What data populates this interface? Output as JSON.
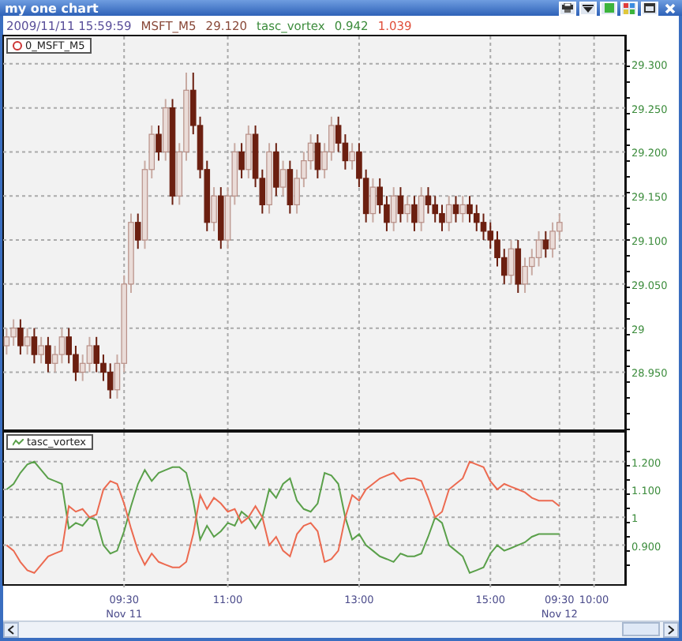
{
  "window": {
    "title": "my one chart"
  },
  "info_bar": [
    {
      "text": "2009/11/11 15:59:59",
      "color": "#5a4f9a"
    },
    {
      "text": "MSFT_M5",
      "color": "#8a4a3a"
    },
    {
      "text": "29.120",
      "color": "#8a4a3a"
    },
    {
      "text": "tasc_vortex",
      "color": "#3c8c3c"
    },
    {
      "text": "0.942",
      "color": "#3c8c3c"
    },
    {
      "text": "1.039",
      "color": "#e0503c"
    }
  ],
  "price_panel": {
    "legend": "0_MSFT_M5",
    "chart_data": {
      "type": "candlestick",
      "grid": true,
      "ylim": [
        28.885,
        29.333
      ],
      "yticks": [
        {
          "value": 29.3,
          "label": "29.300"
        },
        {
          "value": 29.25,
          "label": "29.250"
        },
        {
          "value": 29.2,
          "label": "29.200"
        },
        {
          "value": 29.15,
          "label": "29.150"
        },
        {
          "value": 29.1,
          "label": "29.100"
        },
        {
          "value": 29.05,
          "label": "29.050"
        },
        {
          "value": 29,
          "label": "29"
        },
        {
          "value": 28.95,
          "label": "28.950"
        }
      ],
      "categories": [
        null,
        null,
        null,
        null,
        null,
        null,
        null,
        null,
        null,
        null,
        null,
        null,
        null,
        null,
        null,
        null,
        null,
        null,
        null,
        null,
        null,
        null,
        null,
        null,
        null,
        null,
        null,
        null,
        null,
        null,
        null,
        null,
        null,
        null,
        null,
        null,
        null,
        null,
        null,
        null,
        null,
        null,
        null,
        null,
        null,
        null,
        null,
        null,
        null,
        null,
        null,
        null,
        null,
        null,
        null,
        null,
        null,
        null,
        null,
        null,
        null,
        null,
        null,
        null,
        null,
        null,
        null,
        null,
        null,
        null,
        null,
        null,
        null,
        null,
        null,
        null,
        null,
        null,
        null,
        null,
        null,
        null,
        null,
        null,
        null,
        null,
        null,
        null,
        null,
        null
      ],
      "ohlc": [
        [
          28.98,
          29.0,
          28.97,
          28.99
        ],
        [
          28.99,
          29.01,
          28.98,
          29.0
        ],
        [
          29.0,
          29.01,
          28.97,
          28.98
        ],
        [
          28.98,
          29.0,
          28.97,
          28.99
        ],
        [
          28.99,
          29.0,
          28.96,
          28.97
        ],
        [
          28.97,
          28.99,
          28.96,
          28.98
        ],
        [
          28.98,
          28.99,
          28.95,
          28.96
        ],
        [
          28.96,
          28.98,
          28.95,
          28.97
        ],
        [
          28.97,
          29.0,
          28.96,
          28.99
        ],
        [
          28.99,
          29.0,
          28.96,
          28.97
        ],
        [
          28.97,
          28.98,
          28.94,
          28.95
        ],
        [
          28.95,
          28.97,
          28.94,
          28.96
        ],
        [
          28.96,
          28.99,
          28.95,
          28.98
        ],
        [
          28.98,
          28.99,
          28.95,
          28.96
        ],
        [
          28.96,
          28.97,
          28.94,
          28.95
        ],
        [
          28.95,
          28.96,
          28.92,
          28.93
        ],
        [
          28.93,
          28.97,
          28.92,
          28.96
        ],
        [
          28.96,
          29.06,
          28.95,
          29.05
        ],
        [
          29.05,
          29.13,
          29.04,
          29.12
        ],
        [
          29.12,
          29.13,
          29.09,
          29.1
        ],
        [
          29.1,
          29.19,
          29.09,
          29.18
        ],
        [
          29.18,
          29.23,
          29.17,
          29.22
        ],
        [
          29.22,
          29.23,
          29.19,
          29.2
        ],
        [
          29.2,
          29.26,
          29.19,
          29.25
        ],
        [
          29.25,
          29.26,
          29.14,
          29.15
        ],
        [
          29.15,
          29.21,
          29.14,
          29.2
        ],
        [
          29.2,
          29.29,
          29.19,
          29.27
        ],
        [
          29.27,
          29.29,
          29.22,
          29.23
        ],
        [
          29.23,
          29.24,
          29.17,
          29.18
        ],
        [
          29.18,
          29.19,
          29.11,
          29.12
        ],
        [
          29.12,
          29.16,
          29.11,
          29.15
        ],
        [
          29.15,
          29.16,
          29.09,
          29.1
        ],
        [
          29.1,
          29.16,
          29.09,
          29.15
        ],
        [
          29.15,
          29.21,
          29.14,
          29.2
        ],
        [
          29.2,
          29.21,
          29.17,
          29.18
        ],
        [
          29.18,
          29.23,
          29.17,
          29.22
        ],
        [
          29.22,
          29.23,
          29.16,
          29.17
        ],
        [
          29.17,
          29.18,
          29.13,
          29.14
        ],
        [
          29.14,
          29.21,
          29.13,
          29.2
        ],
        [
          29.2,
          29.21,
          29.15,
          29.16
        ],
        [
          29.16,
          29.19,
          29.15,
          29.18
        ],
        [
          29.18,
          29.19,
          29.13,
          29.14
        ],
        [
          29.14,
          29.18,
          29.13,
          29.17
        ],
        [
          29.17,
          29.2,
          29.16,
          29.19
        ],
        [
          29.19,
          29.22,
          29.18,
          29.21
        ],
        [
          29.21,
          29.22,
          29.17,
          29.18
        ],
        [
          29.18,
          29.21,
          29.17,
          29.2
        ],
        [
          29.2,
          29.24,
          29.19,
          29.23
        ],
        [
          29.23,
          29.24,
          29.2,
          29.21
        ],
        [
          29.21,
          29.22,
          29.18,
          29.19
        ],
        [
          29.19,
          29.21,
          29.18,
          29.2
        ],
        [
          29.2,
          29.21,
          29.16,
          29.17
        ],
        [
          29.17,
          29.18,
          29.12,
          29.13
        ],
        [
          29.13,
          29.17,
          29.12,
          29.16
        ],
        [
          29.16,
          29.17,
          29.13,
          29.14
        ],
        [
          29.14,
          29.15,
          29.11,
          29.12
        ],
        [
          29.12,
          29.16,
          29.11,
          29.15
        ],
        [
          29.15,
          29.16,
          29.12,
          29.13
        ],
        [
          29.13,
          29.15,
          29.12,
          29.14
        ],
        [
          29.14,
          29.15,
          29.11,
          29.12
        ],
        [
          29.12,
          29.16,
          29.11,
          29.15
        ],
        [
          29.15,
          29.16,
          29.13,
          29.14
        ],
        [
          29.14,
          29.15,
          29.12,
          29.13
        ],
        [
          29.13,
          29.14,
          29.11,
          29.12
        ],
        [
          29.12,
          29.15,
          29.11,
          29.14
        ],
        [
          29.14,
          29.15,
          29.12,
          29.13
        ],
        [
          29.13,
          29.15,
          29.12,
          29.14
        ],
        [
          29.14,
          29.15,
          29.12,
          29.13
        ],
        [
          29.13,
          29.14,
          29.11,
          29.12
        ],
        [
          29.12,
          29.13,
          29.1,
          29.11
        ],
        [
          29.11,
          29.12,
          29.09,
          29.1
        ],
        [
          29.1,
          29.11,
          29.07,
          29.08
        ],
        [
          29.08,
          29.09,
          29.05,
          29.06
        ],
        [
          29.06,
          29.1,
          29.05,
          29.09
        ],
        [
          29.09,
          29.1,
          29.04,
          29.05
        ],
        [
          29.05,
          29.08,
          29.04,
          29.07
        ],
        [
          29.07,
          29.09,
          29.06,
          29.08
        ],
        [
          29.08,
          29.11,
          29.07,
          29.1
        ],
        [
          29.1,
          29.11,
          29.08,
          29.09
        ],
        [
          29.09,
          29.12,
          29.08,
          29.11
        ],
        [
          29.11,
          29.13,
          29.1,
          29.12
        ],
        null,
        null,
        null,
        null,
        null,
        null,
        null,
        null,
        null
      ]
    }
  },
  "indicator_panel": {
    "legend": "tasc_vortex",
    "chart_data": {
      "type": "line",
      "grid": true,
      "ylim": [
        0.76,
        1.31
      ],
      "yticks": [
        {
          "value": 1.2,
          "label": "1.200"
        },
        {
          "value": 1.1,
          "label": "1.100"
        },
        {
          "value": 1,
          "label": "1"
        },
        {
          "value": 0.9,
          "label": "0.900"
        }
      ],
      "categories": [
        null,
        null,
        null,
        null,
        null,
        null,
        null,
        null,
        null,
        null,
        null,
        null,
        null,
        null,
        null,
        null,
        null,
        "09:30\nNov 11",
        null,
        null,
        null,
        null,
        null,
        null,
        null,
        null,
        null,
        null,
        null,
        null,
        null,
        null,
        "11:00",
        null,
        null,
        null,
        null,
        null,
        null,
        null,
        null,
        null,
        null,
        null,
        null,
        null,
        null,
        null,
        null,
        null,
        null,
        "13:00",
        null,
        null,
        null,
        null,
        null,
        null,
        null,
        null,
        null,
        null,
        null,
        null,
        null,
        null,
        null,
        null,
        null,
        null,
        "15:00",
        null,
        null,
        null,
        null,
        null,
        null,
        null,
        null,
        null,
        "09:30\nNov 12",
        null,
        null,
        null,
        null,
        "10:00",
        null,
        null,
        null,
        null
      ],
      "series": [
        {
          "color": "#5aa04a",
          "values": [
            1.1,
            1.12,
            1.16,
            1.19,
            1.2,
            1.17,
            1.14,
            1.13,
            1.12,
            0.96,
            0.98,
            0.97,
            1.0,
            0.99,
            0.9,
            0.87,
            0.88,
            0.95,
            1.04,
            1.12,
            1.17,
            1.13,
            1.16,
            1.17,
            1.18,
            1.18,
            1.16,
            1.06,
            0.92,
            0.97,
            0.93,
            0.95,
            0.98,
            0.97,
            1.02,
            1.0,
            0.96,
            1.0,
            1.1,
            1.07,
            1.12,
            1.14,
            1.06,
            1.03,
            1.02,
            1.05,
            1.16,
            1.15,
            1.12,
            1.0,
            0.92,
            0.94,
            0.9,
            0.88,
            0.86,
            0.85,
            0.84,
            0.87,
            0.86,
            0.86,
            0.87,
            0.93,
            1.0,
            0.98,
            0.9,
            0.88,
            0.86,
            0.8,
            0.81,
            0.82,
            0.87,
            0.9,
            0.88,
            0.89,
            0.9,
            0.91,
            0.93,
            0.94,
            0.94,
            0.94,
            0.94,
            null,
            null,
            null,
            null,
            null,
            null,
            null,
            null,
            null
          ]
        },
        {
          "color": "#ec6a50",
          "values": [
            0.9,
            0.88,
            0.84,
            0.81,
            0.8,
            0.83,
            0.86,
            0.87,
            0.88,
            1.04,
            1.02,
            1.03,
            1.0,
            1.01,
            1.1,
            1.13,
            1.12,
            1.05,
            0.96,
            0.88,
            0.83,
            0.87,
            0.84,
            0.83,
            0.82,
            0.82,
            0.84,
            0.94,
            1.08,
            1.03,
            1.07,
            1.05,
            1.02,
            1.03,
            0.98,
            1.0,
            1.04,
            1.0,
            0.9,
            0.93,
            0.88,
            0.86,
            0.94,
            0.97,
            0.98,
            0.95,
            0.84,
            0.85,
            0.88,
            1.0,
            1.08,
            1.06,
            1.1,
            1.12,
            1.14,
            1.15,
            1.16,
            1.13,
            1.14,
            1.14,
            1.13,
            1.07,
            1.0,
            1.02,
            1.1,
            1.12,
            1.14,
            1.2,
            1.19,
            1.18,
            1.13,
            1.1,
            1.12,
            1.11,
            1.1,
            1.09,
            1.07,
            1.06,
            1.06,
            1.06,
            1.04,
            null,
            null,
            null,
            null,
            null,
            null,
            null,
            null,
            null
          ]
        }
      ]
    }
  }
}
